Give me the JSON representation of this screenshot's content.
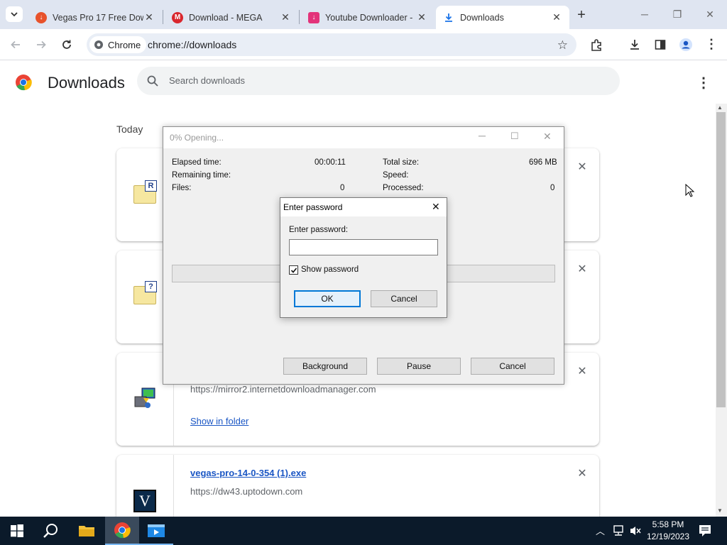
{
  "tabs": [
    {
      "title": "Vegas Pro 17 Free Dow",
      "icon": "uptodown-icon",
      "color": "#e8522b"
    },
    {
      "title": "Download - MEGA",
      "icon": "mega-icon",
      "color": "#d9272e"
    },
    {
      "title": "Youtube Downloader -",
      "icon": "download-site-icon",
      "color": "#e3337a"
    },
    {
      "title": "Downloads",
      "icon": "download-icon",
      "color": "#1a73e8"
    }
  ],
  "omnibox": {
    "chip": "Chrome",
    "url": "chrome://downloads"
  },
  "page": {
    "title": "Downloads",
    "search_placeholder": "Search downloads",
    "date_group": "Today"
  },
  "downloads": [
    {
      "file_icon": "rar-archive-icon",
      "badge": "R"
    },
    {
      "file_icon": "unknown-archive-icon",
      "badge": "?"
    },
    {
      "file_icon": "idm-installer-icon",
      "url": "https://mirror2.internetdownloadmanager.com",
      "action": "Show in folder"
    },
    {
      "file_icon": "vegas-icon",
      "badge": "V",
      "filename": "vegas-pro-14-0-354 (1).exe",
      "url": "https://dw43.uptodown.com"
    }
  ],
  "progress_dialog": {
    "title": "0% Opening...",
    "elapsed_label": "Elapsed time:",
    "elapsed_value": "00:00:11",
    "remaining_label": "Remaining time:",
    "files_label": "Files:",
    "files_value": "0",
    "total_label": "Total size:",
    "total_value": "696 MB",
    "speed_label": "Speed:",
    "processed_label": "Processed:",
    "processed_value": "0",
    "progress": 0,
    "background_btn": "Background",
    "pause_btn": "Pause",
    "cancel_btn": "Cancel"
  },
  "password_dialog": {
    "title": "Enter password",
    "field_label": "Enter password:",
    "field_value": "",
    "show_password_label": "Show password",
    "show_password_checked": true,
    "ok_btn": "OK",
    "cancel_btn": "Cancel"
  },
  "taskbar": {
    "time": "5:58 PM",
    "date": "12/19/2023",
    "items": [
      "start-icon",
      "search-icon",
      "file-explorer-icon",
      "chrome-icon",
      "media-player-icon"
    ]
  }
}
